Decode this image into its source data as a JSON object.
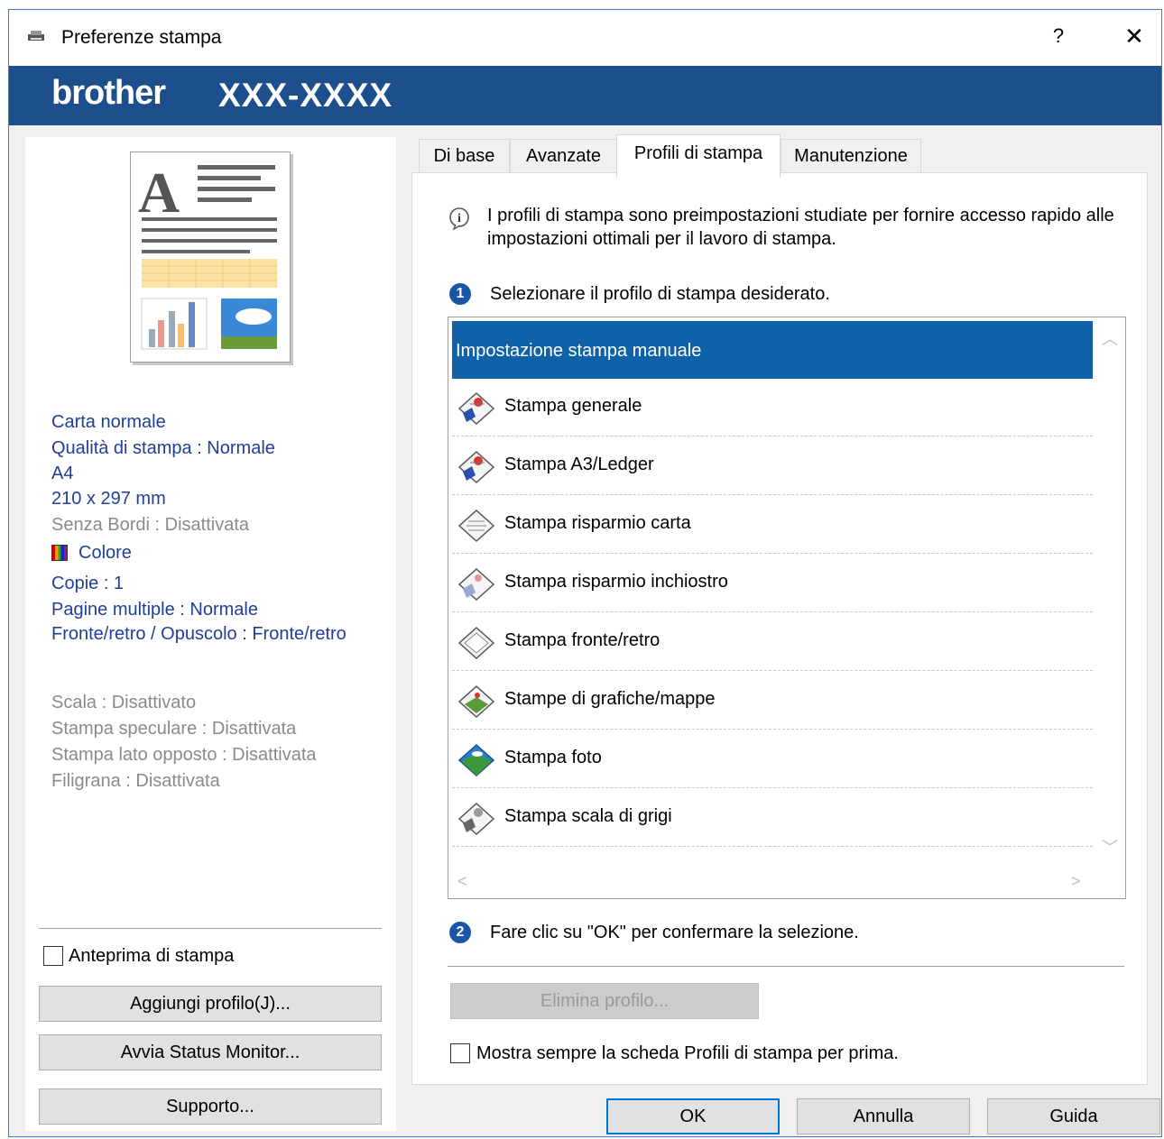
{
  "window": {
    "title": "Preferenze stampa",
    "help_label": "?",
    "close_label": "✕"
  },
  "brand": {
    "logo": "brother",
    "model": "XXX-XXXX"
  },
  "summary": {
    "blue_lines": [
      "Carta normale",
      "Qualità di stampa : Normale",
      "A4",
      "210 x 297 mm"
    ],
    "borderless": "Senza Bordi : Disattivata",
    "color": "Colore",
    "blue_lines2": [
      "Copie : 1",
      "Pagine multiple : Normale",
      "Fronte/retro / Opuscolo : Fronte/retro"
    ],
    "gray_lines": [
      "Scala : Disattivato",
      "Stampa speculare : Disattivata",
      "Stampa lato opposto : Disattivata",
      "Filigrana : Disattivata"
    ]
  },
  "left_controls": {
    "preview_checkbox": "Anteprima di stampa",
    "add_profile": "Aggiungi profilo(J)...",
    "status_monitor": "Avvia Status Monitor...",
    "support": "Supporto..."
  },
  "tabs": [
    "Di base",
    "Avanzate",
    "Profili di stampa",
    "Manutenzione"
  ],
  "active_tab": "Profili di stampa",
  "profiles_tab": {
    "info_line1": "I profili di stampa sono preimpostazioni studiate per fornire accesso rapido alle",
    "info_line2": "impostazioni ottimali per il lavoro di stampa.",
    "step1_number": "1",
    "step1_text": "Selezionare il profilo di stampa desiderato.",
    "profiles": [
      "Impostazione stampa manuale",
      "Stampa generale",
      "Stampa A3/Ledger",
      "Stampa risparmio carta",
      "Stampa risparmio inchiostro",
      "Stampa fronte/retro",
      "Stampe di grafiche/mappe",
      "Stampa foto",
      "Stampa scala di grigi"
    ],
    "selected_profile": "Impostazione stampa manuale",
    "step2_number": "2",
    "step2_text": "Fare clic su \"OK\" per confermare la selezione.",
    "delete_profile": "Elimina profilo...",
    "always_show_checkbox": "Mostra sempre la scheda Profili di stampa per prima."
  },
  "footer": {
    "ok": "OK",
    "cancel": "Annulla",
    "help": "Guida"
  },
  "colors": {
    "brand_bar": "#1d4f8c",
    "selection": "#0f62a8",
    "summary_text": "#1f3f98"
  }
}
